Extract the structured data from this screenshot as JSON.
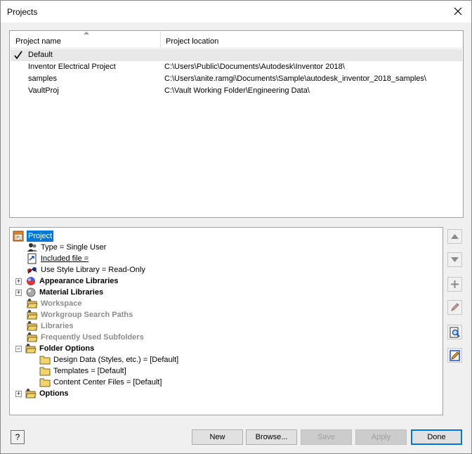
{
  "window": {
    "title": "Projects"
  },
  "projects": {
    "columns": {
      "name": "Project name",
      "location": "Project location"
    },
    "rows": [
      {
        "name": "Default",
        "location": "",
        "active": true
      },
      {
        "name": "Inventor Electrical Project",
        "location": "C:\\Users\\Public\\Documents\\Autodesk\\Inventor 2018\\"
      },
      {
        "name": "samples",
        "location": "C:\\Users\\anite.ramgi\\Documents\\Sample\\autodesk_inventor_2018_samples\\"
      },
      {
        "name": "VaultProj",
        "location": "C:\\Vault Working Folder\\Engineering Data\\"
      }
    ]
  },
  "tree": {
    "root": "Project",
    "items": [
      {
        "label": "Type = Single User",
        "icon": "users-icon"
      },
      {
        "label": "Included file = ",
        "icon": "link-file-icon"
      },
      {
        "label": "Use Style Library = Read-Only",
        "icon": "style-library-icon"
      },
      {
        "label": "Appearance Libraries",
        "icon": "appearance-icon",
        "expander": "+"
      },
      {
        "label": "Material Libraries",
        "icon": "material-icon",
        "expander": "+"
      },
      {
        "label": "Workspace",
        "icon": "folder-open-icon"
      },
      {
        "label": "Workgroup Search Paths",
        "icon": "folder-open-icon"
      },
      {
        "label": "Libraries",
        "icon": "folder-open-icon"
      },
      {
        "label": "Frequently Used Subfolders",
        "icon": "folder-open-icon"
      },
      {
        "label": "Folder Options",
        "icon": "folder-open-icon",
        "expander": "−"
      },
      {
        "label": "Design Data (Styles, etc.) = [Default]",
        "icon": "folder-icon"
      },
      {
        "label": "Templates = [Default]",
        "icon": "folder-icon"
      },
      {
        "label": "Content Center Files = [Default]",
        "icon": "folder-icon"
      },
      {
        "label": "Options",
        "icon": "folder-open-icon",
        "expander": "+"
      }
    ]
  },
  "buttons": {
    "help": "?",
    "new": "New",
    "browse": "Browse...",
    "save": "Save",
    "apply": "Apply",
    "done": "Done"
  },
  "colors": {
    "selection": "#0078d7",
    "disabled_text": "#a0a0a0",
    "folder": "#f3d46b"
  }
}
